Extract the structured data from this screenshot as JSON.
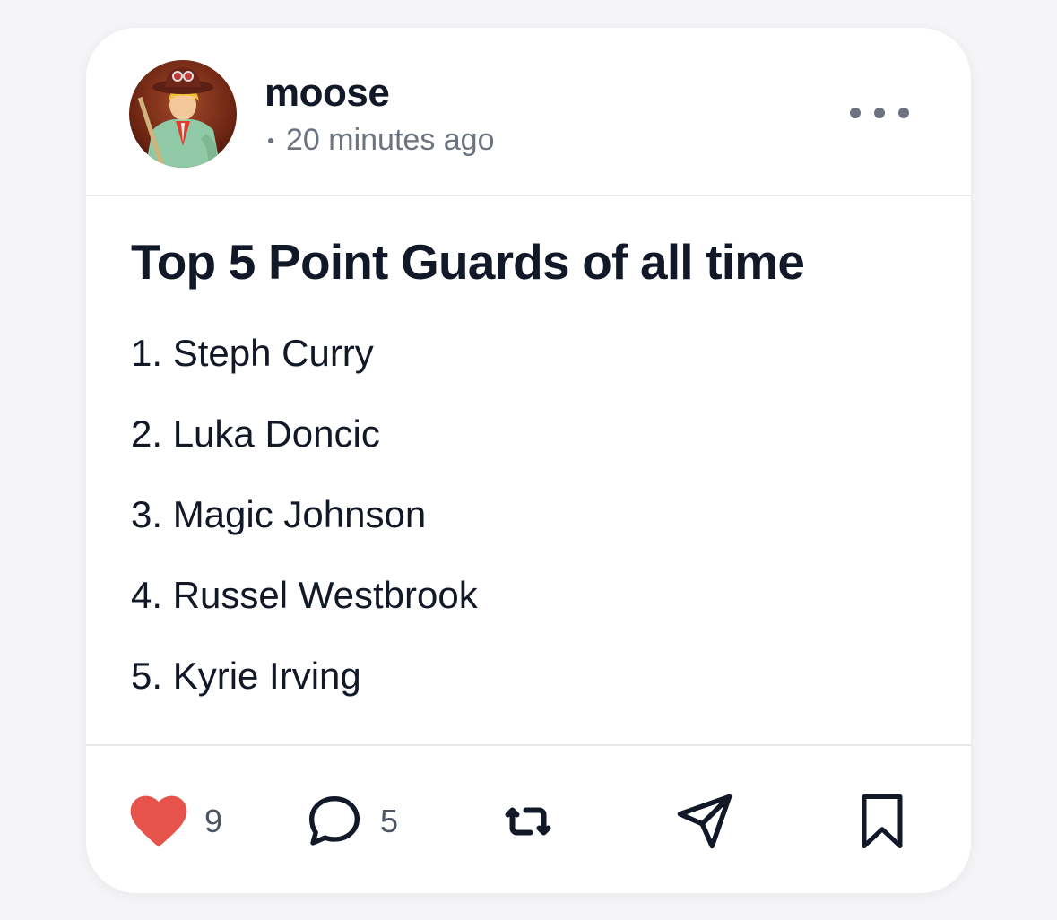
{
  "post": {
    "username": "moose",
    "timestamp": "20 minutes ago",
    "title": "Top 5 Point Guards of all time",
    "items": [
      "1. Steph Curry",
      "2. Luka Doncic",
      "3. Magic Johnson",
      "4. Russel Westbrook",
      "5. Kyrie Irving"
    ]
  },
  "actions": {
    "likes": "9",
    "comments": "5",
    "like_icon": "heart-icon",
    "comment_icon": "speech-bubble-icon",
    "repost_icon": "repost-icon",
    "share_icon": "paper-plane-icon",
    "bookmark_icon": "bookmark-icon"
  },
  "colors": {
    "like": "#e5534b",
    "text": "#111827",
    "muted": "#6b7280",
    "divider": "#e5e7eb"
  }
}
